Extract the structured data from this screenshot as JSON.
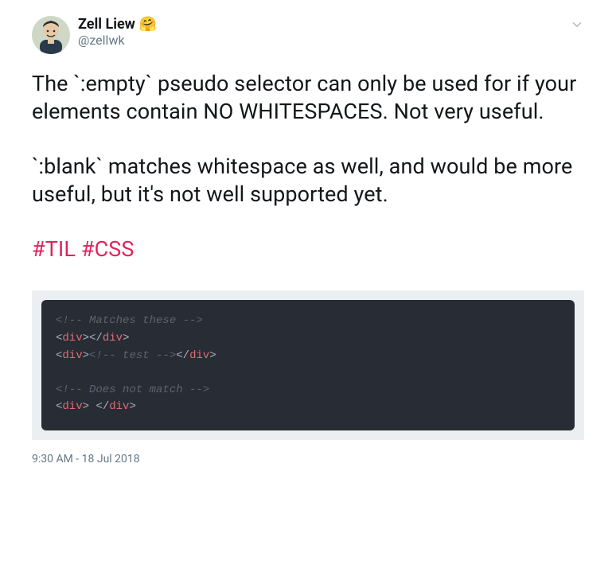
{
  "user": {
    "display_name": "Zell Liew",
    "emoji": "🤗",
    "handle": "@zellwk"
  },
  "tweet": {
    "paragraph1": "The `:empty` pseudo selector can only be used for if your elements contain NO WHITESPACES. Not very useful.",
    "paragraph2": "`:blank` matches whitespace as well, and would be more useful, but it's not well supported yet.",
    "hashtag1": "#TIL",
    "hashtag2": "#CSS"
  },
  "code": {
    "line1_comment": "<!-- Matches these -->",
    "line2_open_b": "<",
    "line2_tag": "div",
    "line2_close_b1": ">",
    "line2_open_b2": "</",
    "line2_close_b2": ">",
    "line3_open_b": "<",
    "line3_tag": "div",
    "line3_close_b1": ">",
    "line3_comment": "<!-- test -->",
    "line3_open_b2": "</",
    "line3_close_b2": ">",
    "line4_comment": "<!-- Does not match -->",
    "line5_open_b": "<",
    "line5_tag": "div",
    "line5_close_b1": ">",
    "line5_space": " ",
    "line5_open_b2": "</",
    "line5_close_b2": ">"
  },
  "timestamp": "9:30 AM - 18 Jul 2018"
}
